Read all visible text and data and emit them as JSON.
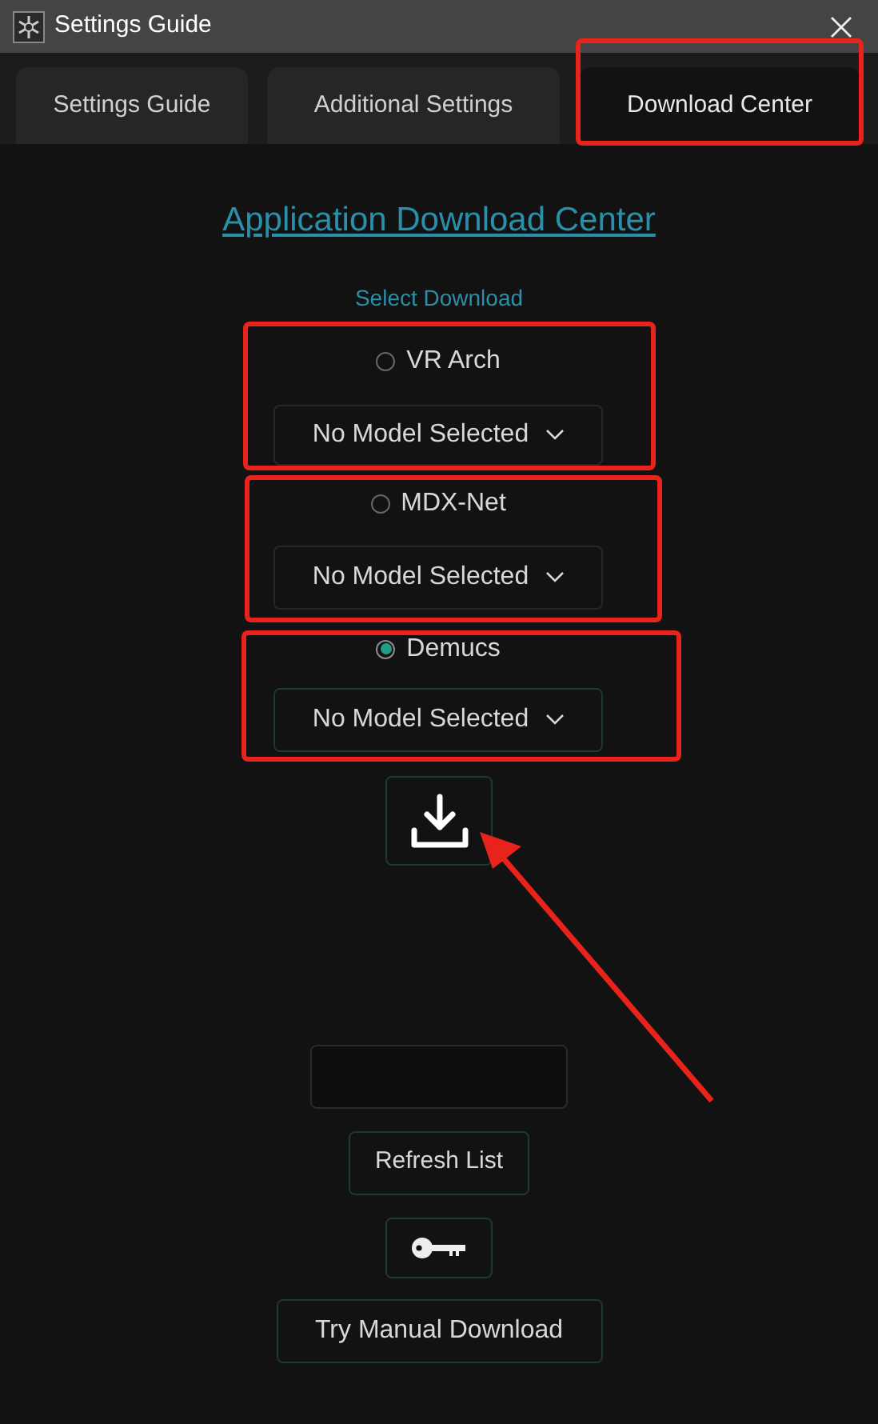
{
  "window": {
    "title": "Settings Guide"
  },
  "tabs": [
    {
      "label": "Settings Guide",
      "selected": false
    },
    {
      "label": "Additional Settings",
      "selected": false
    },
    {
      "label": "Download Center",
      "selected": true
    }
  ],
  "heading": "Application Download Center",
  "select_label": "Select Download",
  "options": [
    {
      "label": "VR Arch",
      "selected": false,
      "dropdown": "No Model Selected"
    },
    {
      "label": "MDX-Net",
      "selected": false,
      "dropdown": "No Model Selected"
    },
    {
      "label": "Demucs",
      "selected": true,
      "dropdown": "No Model Selected"
    }
  ],
  "buttons": {
    "refresh": "Refresh List",
    "manual": "Try Manual Download"
  }
}
